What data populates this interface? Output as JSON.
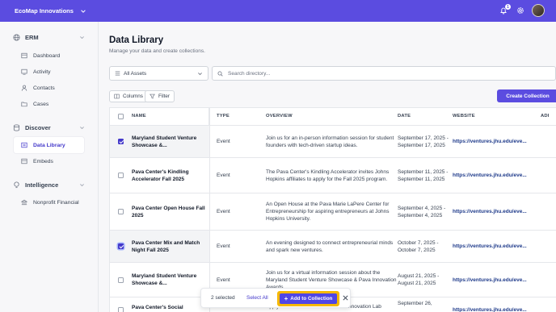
{
  "org": {
    "name": "EcoMap Innovations"
  },
  "header": {
    "notification_count": "1"
  },
  "sidebar": {
    "sections": [
      {
        "label": "ERM",
        "icon": "globe-icon",
        "items": [
          {
            "label": "Dashboard",
            "icon": "dashboard-icon"
          },
          {
            "label": "Activity",
            "icon": "activity-icon"
          },
          {
            "label": "Contacts",
            "icon": "user-icon"
          },
          {
            "label": "Cases",
            "icon": "folder-icon"
          }
        ]
      },
      {
        "label": "Discover",
        "icon": "database-icon",
        "items": [
          {
            "label": "Data Library",
            "icon": "library-icon",
            "active": true
          },
          {
            "label": "Embeds",
            "icon": "embed-icon"
          }
        ]
      },
      {
        "label": "Intelligence",
        "icon": "bulb-icon",
        "items": [
          {
            "label": "Nonprofit Financial",
            "icon": "bank-icon"
          }
        ]
      }
    ]
  },
  "page": {
    "title": "Data Library",
    "subtitle": "Manage your data and create collections."
  },
  "filters": {
    "asset_select": "All Assets",
    "search_placeholder": "Search directory..."
  },
  "toolbar": {
    "columns_label": "Columns",
    "filter_label": "Filter",
    "create_collection_label": "Create Collection"
  },
  "table": {
    "headers": {
      "name": "NAME",
      "type": "TYPE",
      "overview": "OVERVIEW",
      "date": "DATE",
      "website": "WEBSITE",
      "extra": "ADI"
    },
    "rows": [
      {
        "selected": true,
        "name": "Maryland Student Venture Showcase &...",
        "type": "Event",
        "overview": "Join us for an in-person information session for student founders with tech-driven startup ideas.",
        "date": "September 17, 2025 - September 17, 2025",
        "website": "https://ventures.jhu.edu/eve..."
      },
      {
        "selected": false,
        "name": "Pava Center's Kindling Accelerator Fall 2025",
        "type": "Event",
        "overview": "The Pava Center's Kindling Accelerator invites Johns Hopkins affiliates to apply for the Fall 2025 program.",
        "date": "September 11, 2025 - September 11, 2025",
        "website": "https://ventures.jhu.edu/eve..."
      },
      {
        "selected": false,
        "name": "Pava Center Open House Fall 2025",
        "type": "Event",
        "overview": "An Open House at the Pava Marie LaPere Center for Entrepreneurship for aspiring entrepreneurs at Johns Hopkins University.",
        "date": "September 4, 2025 - September 4, 2025",
        "website": "https://ventures.jhu.edu/eve..."
      },
      {
        "selected": true,
        "name": "Pava Center Mix and Match Night Fall 2025",
        "type": "Event",
        "overview": "An evening designed to connect entrepreneurial minds and spark new ventures.",
        "date": "October 7, 2025 - October 7, 2025",
        "website": "https://ventures.jhu.edu/eve..."
      },
      {
        "selected": false,
        "name": "Maryland Student Venture Showcase &...",
        "type": "Event",
        "overview": "Join us for a virtual information session about the Maryland Student Venture Showcase & Pava Innovation Awards.",
        "date": "August 21, 2025 - August 21, 2025",
        "website": "https://ventures.jhu.edu/eve..."
      },
      {
        "selected": false,
        "name": "Pava Center's Social",
        "type": "",
        "overview": "Apply for the Pava Center's Social Innovation Lab",
        "date": "September 26,",
        "website": "https://ventures.jhu.edu/eve..."
      }
    ]
  },
  "action_bar": {
    "selected_text": "2 selected",
    "select_all_label": "Select All",
    "add_to_collection_label": "Add to Collection"
  },
  "colors": {
    "brand": "#5b4ce0",
    "highlight": "#f5b800",
    "link": "#1e3a8a"
  }
}
